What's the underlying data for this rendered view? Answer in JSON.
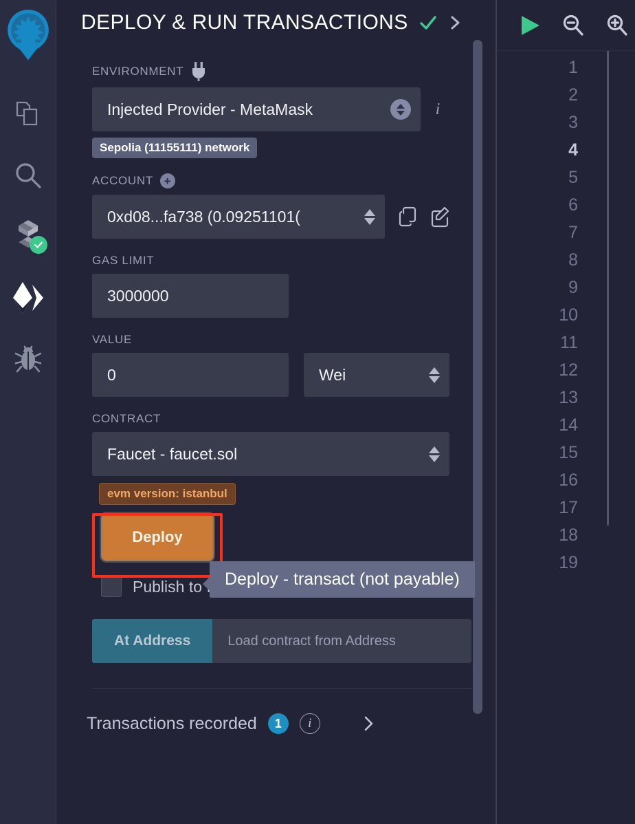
{
  "sidebar": {
    "logo": {
      "name": "remix-logo",
      "color": "#1c7aad"
    },
    "items": [
      {
        "id": "file-explorer",
        "icon": "files-icon",
        "label": "File explorer",
        "active": false
      },
      {
        "id": "search",
        "icon": "search-icon",
        "label": "Search in files",
        "active": false
      },
      {
        "id": "solidity-compiler",
        "icon": "solidity-compiler-icon",
        "label": "Solidity compiler",
        "active": false,
        "badge": "check"
      },
      {
        "id": "deploy-run",
        "icon": "deploy-run-icon",
        "label": "Deploy & run transactions",
        "active": true
      },
      {
        "id": "debugger",
        "icon": "bug-icon",
        "label": "Debugger",
        "active": false
      }
    ]
  },
  "panel": {
    "title": "DEPLOY & RUN TRANSACTIONS",
    "header_check_icon": "check-icon",
    "header_chevron_icon": "chevron-right-icon",
    "environment": {
      "label": "ENVIRONMENT",
      "icon": "plug-icon",
      "value": "Injected Provider - MetaMask",
      "info_icon": "info-icon",
      "network_badge": "Sepolia (11155111) network"
    },
    "account": {
      "label": "ACCOUNT",
      "add_icon": "plus-circle-icon",
      "value": "0xd08...fa738 (0.09251101(",
      "copy_icon": "copy-icon",
      "edit_icon": "edit-icon"
    },
    "gas_limit": {
      "label": "GAS LIMIT",
      "value": "3000000"
    },
    "value_field": {
      "label": "VALUE",
      "value": "0",
      "unit": "Wei"
    },
    "contract": {
      "label": "CONTRACT",
      "value": "Faucet - faucet.sol",
      "evm_badge": "evm version: istanbul"
    },
    "deploy": {
      "button_label": "Deploy",
      "tooltip": "Deploy - transact (not payable)",
      "highlight_color": "#ff2d16",
      "button_color": "#cb7b35"
    },
    "ipfs": {
      "label": "Publish to IPFS",
      "checked": false
    },
    "at_address": {
      "button_label": "At Address",
      "placeholder": "Load contract from Address"
    },
    "transactions": {
      "label": "Transactions recorded",
      "count": "1",
      "info_icon": "info-circle-icon",
      "chevron_icon": "chevron-right-icon"
    }
  },
  "editor": {
    "toolbar": [
      {
        "id": "run",
        "icon": "play-icon",
        "color": "#3ec98c"
      },
      {
        "id": "zoom-out",
        "icon": "zoom-out-icon",
        "color": "#c3c6d6"
      },
      {
        "id": "zoom-in",
        "icon": "zoom-in-icon",
        "color": "#c3c6d6"
      }
    ],
    "line_numbers": [
      "1",
      "2",
      "3",
      "4",
      "5",
      "6",
      "7",
      "8",
      "9",
      "10",
      "11",
      "12",
      "13",
      "14",
      "15",
      "16",
      "17",
      "18",
      "19"
    ],
    "active_line": "4"
  }
}
